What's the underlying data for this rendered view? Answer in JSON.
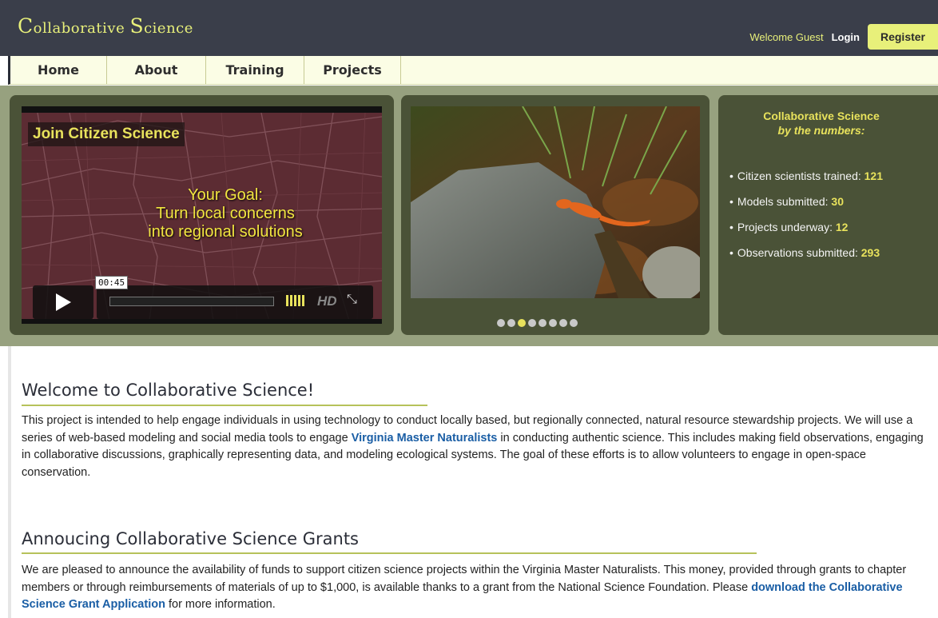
{
  "header": {
    "logo_c1": "C",
    "logo_rest1": "ollaborative ",
    "logo_s": "S",
    "logo_rest2": "cience",
    "welcome": "Welcome Guest",
    "login": "Login",
    "register": "Register"
  },
  "nav": [
    {
      "label": "Home"
    },
    {
      "label": "About"
    },
    {
      "label": "Training"
    },
    {
      "label": "Projects"
    }
  ],
  "video": {
    "title": "Join Citizen Science",
    "goal_line1": "Your Goal:",
    "goal_line2": "Turn local concerns",
    "goal_line3": "into regional solutions",
    "time": "00:45",
    "hd": "HD",
    "progress": 0
  },
  "slideshow": {
    "slide_count": 8,
    "active_index": 2
  },
  "stats": {
    "title": "Collaborative Science",
    "subtitle": "by the numbers:",
    "items": [
      {
        "label": "Citizen scientists trained: ",
        "value": "121"
      },
      {
        "label": "Models submitted: ",
        "value": "30"
      },
      {
        "label": "Projects underway: ",
        "value": "12"
      },
      {
        "label": "Observations submitted: ",
        "value": "293"
      }
    ]
  },
  "welcome_section": {
    "heading": "Welcome to Collaborative Science!",
    "text_before": "This project is intended to help engage individuals in using technology to conduct locally based, but regionally connected, natural resource stewardship projects. We will use a series of web-based modeling and social media tools to engage ",
    "link": "Virginia Master Naturalists",
    "text_after": " in conducting authentic science. This includes making field observations, engaging in collaborative discussions, graphically representing data, and modeling ecological systems. The goal of these efforts is to allow volunteers to engage in open-space conservation."
  },
  "grants_section": {
    "heading": "Annoucing Collaborative Science Grants",
    "text_before": "We are pleased to announce the availability of funds to support citizen science projects within the Virginia Master Naturalists. This money, provided through grants to chapter members or through reimbursements of materials of up to $1,000, is available thanks to a grant from the National Science Foundation. Please ",
    "link": "download the Collaborative Science Grant Application",
    "text_after": " for more information."
  },
  "colors": {
    "header_bg": "#3a3e4a",
    "accent_yellow": "#e8f07a",
    "band_green": "#97a17f",
    "panel_dark": "#4a5237",
    "link_blue": "#1a5ea5"
  }
}
